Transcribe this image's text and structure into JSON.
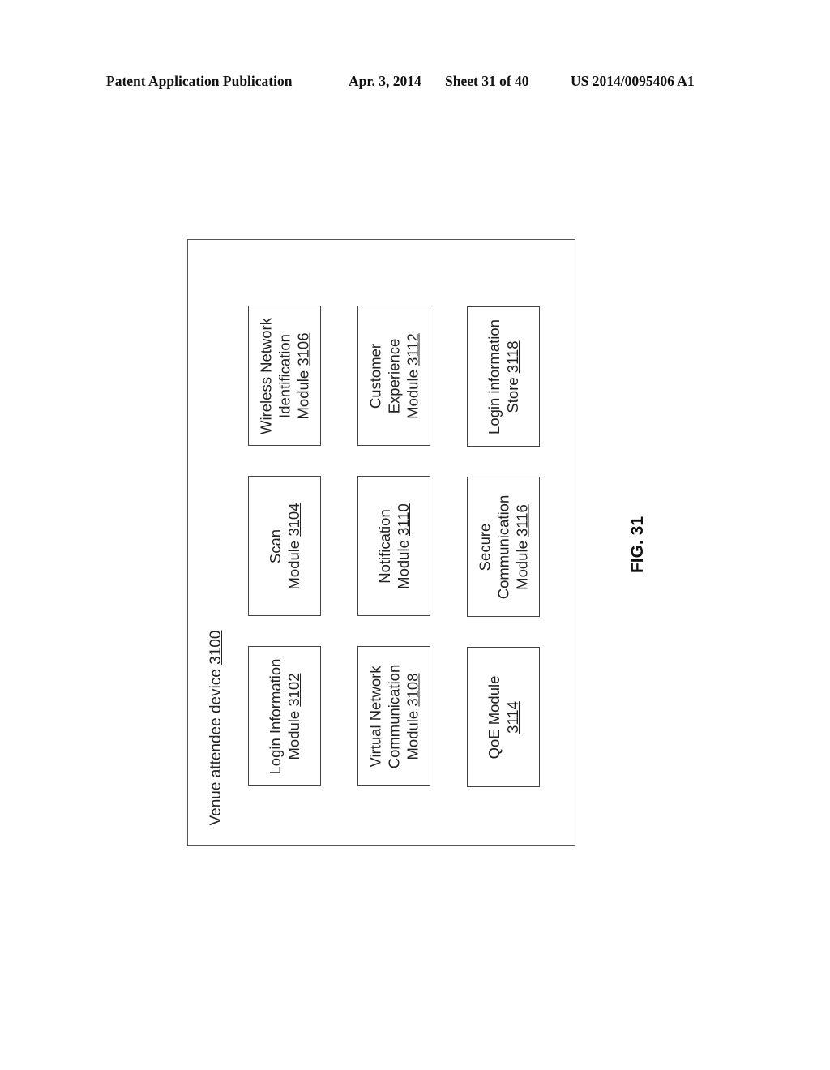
{
  "header": {
    "publication": "Patent Application Publication",
    "date": "Apr. 3, 2014",
    "sheet": "Sheet 31 of 40",
    "number": "US 2014/0095406 A1"
  },
  "diagram": {
    "container": {
      "label": "Venue attendee device",
      "ref": "3100"
    },
    "modules": [
      {
        "lines": [
          "Login Information",
          "Module"
        ],
        "ref": "3102"
      },
      {
        "lines": [
          "Scan",
          "Module"
        ],
        "ref": "3104"
      },
      {
        "lines": [
          "Wireless Network",
          "Identification",
          "Module"
        ],
        "ref": "3106"
      },
      {
        "lines": [
          "Virtual Network",
          "Communication",
          "Module"
        ],
        "ref": "3108"
      },
      {
        "lines": [
          "Notification",
          "Module"
        ],
        "ref": "3110"
      },
      {
        "lines": [
          "Customer",
          "Experience",
          "Module"
        ],
        "ref": "3112"
      },
      {
        "lines": [
          "QoE Module"
        ],
        "ref": "3114",
        "ref_on_own_line": true
      },
      {
        "lines": [
          "Secure",
          "Communication",
          "Module"
        ],
        "ref": "3116"
      },
      {
        "lines": [
          "Login information",
          "Store"
        ],
        "ref": "3118"
      }
    ],
    "figure_label": "FIG. 31"
  }
}
